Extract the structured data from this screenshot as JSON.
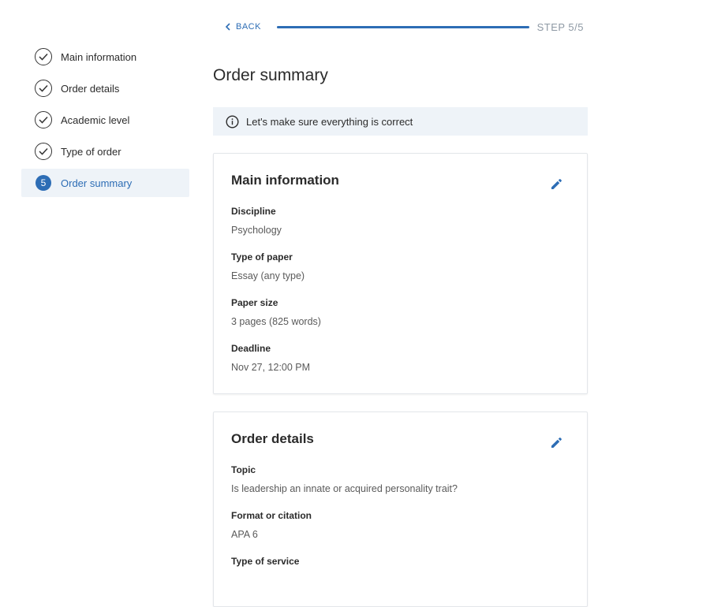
{
  "topbar": {
    "back_label": "BACK",
    "progress_fraction": 1.0,
    "step_label": "STEP 5/5",
    "accent_color": "#2d6db5"
  },
  "sidebar": {
    "items": [
      {
        "label": "Main information",
        "state": "done"
      },
      {
        "label": "Order details",
        "state": "done"
      },
      {
        "label": "Academic level",
        "state": "done"
      },
      {
        "label": "Type of order",
        "state": "done"
      },
      {
        "label": "Order summary",
        "state": "active",
        "number": "5"
      }
    ]
  },
  "main": {
    "title": "Order summary",
    "banner_text": "Let's make sure everything is correct",
    "cards": [
      {
        "title": "Main information",
        "fields": [
          {
            "label": "Discipline",
            "value": "Psychology"
          },
          {
            "label": "Type of paper",
            "value": "Essay (any type)"
          },
          {
            "label": "Paper size",
            "value": "3 pages (825 words)"
          },
          {
            "label": "Deadline",
            "value": "Nov 27, 12:00 PM"
          }
        ]
      },
      {
        "title": "Order details",
        "fields": [
          {
            "label": "Topic",
            "value": "Is leadership an innate or acquired personality trait?"
          },
          {
            "label": "Format or citation",
            "value": "APA 6"
          },
          {
            "label": "Type of service",
            "value": ""
          }
        ]
      }
    ]
  }
}
